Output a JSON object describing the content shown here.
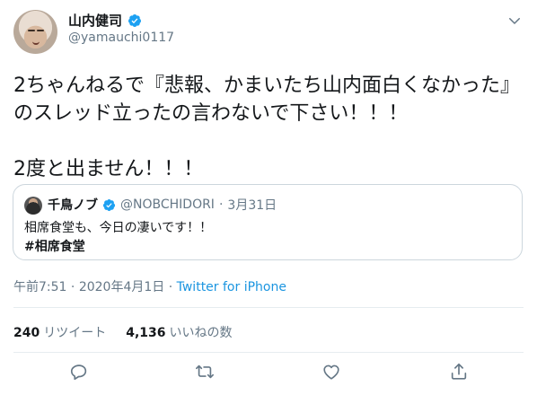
{
  "author": {
    "display_name": "山内健司",
    "handle": "@yamauchi0117"
  },
  "tweet": {
    "text": "2ちゃんねるで『悲報、かまいたち山内面白くなかった』のスレッド立ったの言わないで下さい！！！\n\n2度と出ません！！！"
  },
  "quoted_tweet": {
    "display_name": "千鳥ノブ",
    "handle": "@NOBCHIDORI",
    "separator": "·",
    "date": "3月31日",
    "text": "相席食堂も、今日の凄いです！！",
    "hashtag": "#相席食堂"
  },
  "meta": {
    "time": "午前7:51",
    "separator1": " · ",
    "date": "2020年4月1日",
    "separator2": " · ",
    "source": "Twitter for iPhone"
  },
  "stats": {
    "retweets_count": "240",
    "retweets_label": "リツイート",
    "likes_count": "4,136",
    "likes_label": "いいねの数"
  },
  "icons": {
    "verified": "verified-badge-icon",
    "menu": "chevron-down-icon",
    "reply": "reply-icon",
    "retweet": "retweet-icon",
    "like": "heart-icon",
    "share": "share-icon"
  },
  "colors": {
    "accent": "#1da1f2",
    "link": "#1b95e0",
    "secondary_text": "#657786",
    "border": "#ccd6dd"
  }
}
